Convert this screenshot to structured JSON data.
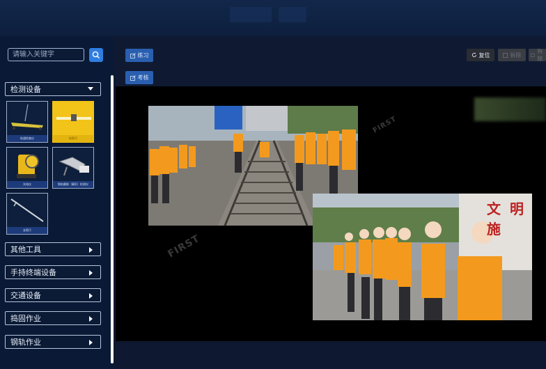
{
  "search": {
    "placeholder": "请输入关键字"
  },
  "categories": [
    {
      "label": "检测设备",
      "expanded": true
    },
    {
      "label": "其他工具"
    },
    {
      "label": "手持终端设备"
    },
    {
      "label": "交通设备"
    },
    {
      "label": "捣固作业"
    },
    {
      "label": "钢轨作业"
    }
  ],
  "tools": [
    {
      "label": "轨道检查仪"
    },
    {
      "label": "轨距尺"
    },
    {
      "label": "光电仪"
    },
    {
      "label": "钢轨磨耗（廓形）检测仪"
    },
    {
      "label": "支距尺"
    }
  ],
  "toolbar": {
    "practice_label": "练习",
    "exam_label": "考核",
    "reset_label": "复位",
    "btn2_label": "拆除",
    "btn3_label": "拆除"
  },
  "stage": {
    "sign_text": "文 明 施",
    "watermark": "FIRST"
  },
  "colors": {
    "accent": "#2f7de0",
    "selected_tile": "#f2c318",
    "vest": "#f39a1e"
  }
}
